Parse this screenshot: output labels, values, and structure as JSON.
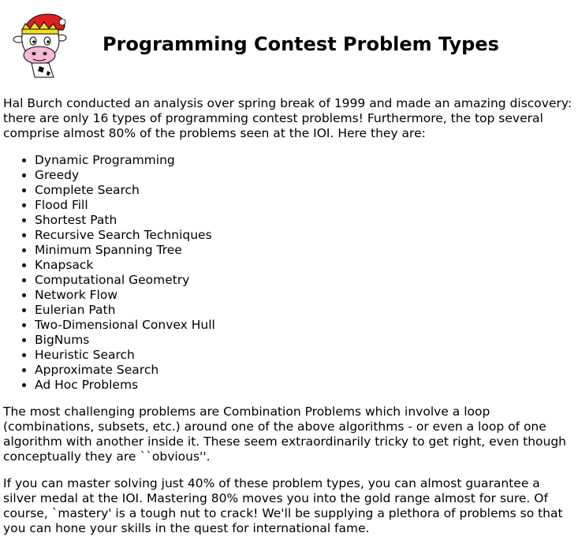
{
  "title": "Programming Contest Problem Types",
  "logo": {
    "icon": "cow-with-santa-hat-icon",
    "colors": {
      "hat": "#e02020",
      "hat_trim": "#ffffff",
      "crown": "#f0e020",
      "face": "#f8b8d8",
      "outline": "#000000"
    }
  },
  "intro": "Hal Burch conducted an analysis over spring break of 1999 and made an amazing discovery: there are only 16 types of programming contest problems! Furthermore, the top several comprise almost 80% of the problems seen at the IOI. Here they are:",
  "problem_types": [
    "Dynamic Programming",
    "Greedy",
    "Complete Search",
    "Flood Fill",
    "Shortest Path",
    "Recursive Search Techniques",
    "Minimum Spanning Tree",
    "Knapsack",
    "Computational Geometry",
    "Network Flow",
    "Eulerian Path",
    "Two-Dimensional Convex Hull",
    "BigNums",
    "Heuristic Search",
    "Approximate Search",
    "Ad Hoc Problems"
  ],
  "paragraph_2": "The most challenging problems are Combination Problems which involve a loop (combinations, subsets, etc.) around one of the above algorithms - or even a loop of one algorithm with another inside it. These seem extraordinarily tricky to get right, even though conceptually they are ``obvious''.",
  "paragraph_3": "If you can master solving just 40% of these problem types, you can almost guarantee a silver medal at the IOI. Mastering 80% moves you into the gold range almost for sure. Of course, `mastery' is a tough nut to crack! We'll be supplying a plethora of problems so that you can hone your skills in the quest for international fame."
}
